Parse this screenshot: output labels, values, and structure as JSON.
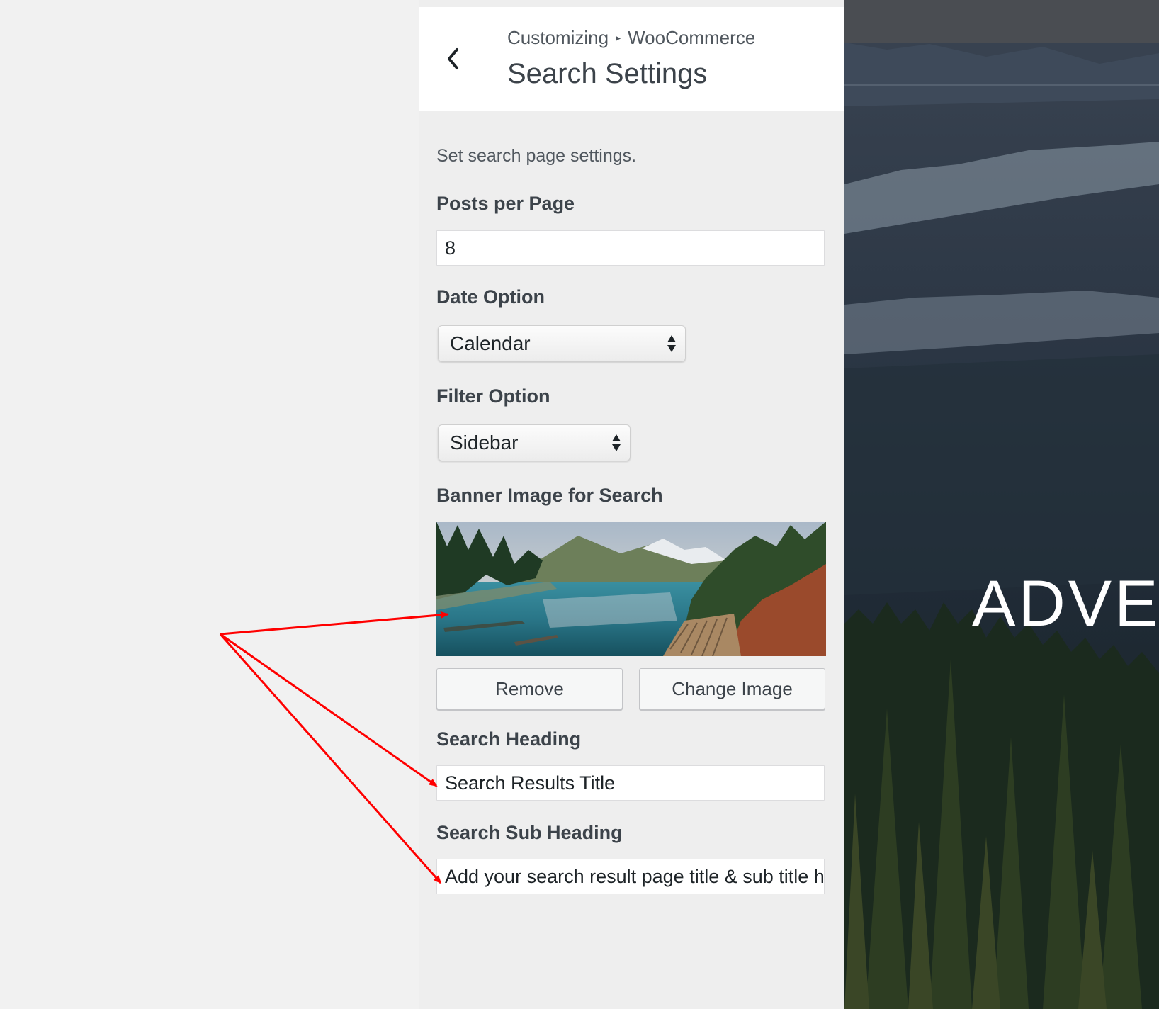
{
  "header": {
    "breadcrumb_root": "Customizing",
    "breadcrumb_separator": "▸",
    "breadcrumb_section": "WooCommerce",
    "title": "Search Settings"
  },
  "panel": {
    "description": "Set search page settings.",
    "posts_per_page": {
      "label": "Posts per Page",
      "value": "8"
    },
    "date_option": {
      "label": "Date Option",
      "selected": "Calendar"
    },
    "filter_option": {
      "label": "Filter Option",
      "selected": "Sidebar"
    },
    "banner": {
      "label": "Banner Image for Search",
      "remove_label": "Remove",
      "change_label": "Change Image"
    },
    "search_heading": {
      "label": "Search Heading",
      "value": "Search Results Title"
    },
    "search_sub_heading": {
      "label": "Search Sub Heading",
      "value": "Add your search result page title & sub title here"
    }
  },
  "preview": {
    "title": "ADVEN"
  },
  "colors": {
    "annotation_arrow": "#ff0000",
    "panel_bg": "#eeeeee",
    "header_bg": "#ffffff"
  },
  "icons": {
    "back": "chevron-left-icon",
    "select_arrows": "up-down-arrows-icon"
  }
}
